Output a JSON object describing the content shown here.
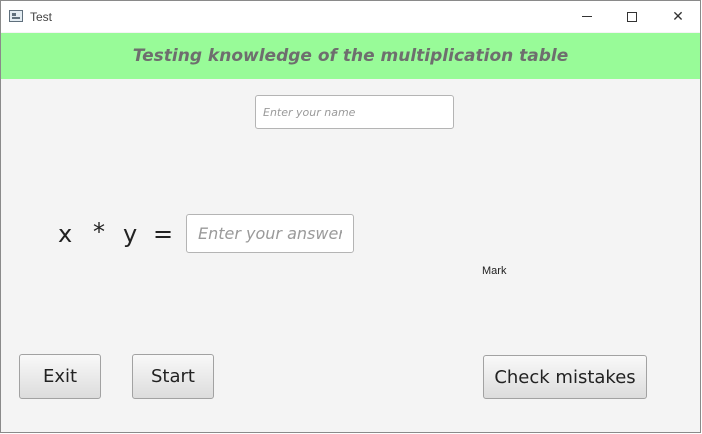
{
  "window": {
    "title": "Test",
    "icon": "app-window-icon",
    "controls": {
      "minimize": "minimize-icon",
      "maximize": "maximize-icon",
      "close": "close-icon"
    },
    "close_glyph": "✕"
  },
  "header": {
    "title": "Testing knowledge of the multiplication table",
    "background": "#98fb98",
    "text_color": "#6e6e6e"
  },
  "name_field": {
    "value": "",
    "placeholder": "Enter your name"
  },
  "equation": {
    "left": "x",
    "operator": "*",
    "right": "y",
    "equals": "="
  },
  "answer_field": {
    "value": "",
    "placeholder": "Enter your answer"
  },
  "mark": {
    "label": "Mark"
  },
  "buttons": {
    "exit": "Exit",
    "start": "Start",
    "check": "Check mistakes"
  }
}
